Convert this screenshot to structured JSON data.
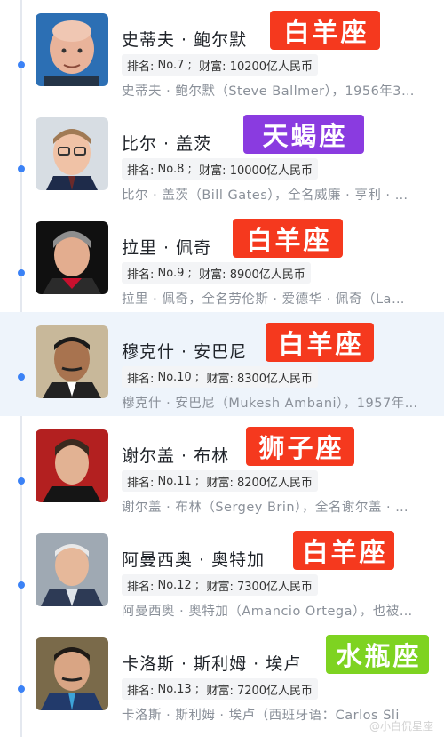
{
  "items": [
    {
      "name": "史蒂夫 · 鲍尔默",
      "zodiac": "白羊座",
      "zodiac_color": "#f5391e",
      "rank_label": "排名:",
      "rank": "No.7 ;",
      "wealth_label": "财富:",
      "wealth": "10200亿人民币",
      "desc": "史蒂夫 · 鲍尔默（Steve Ballmer），1956年3…",
      "photo": "steve-ballmer-photo"
    },
    {
      "name": "比尔 · 盖茨",
      "zodiac": "天蝎座",
      "zodiac_color": "#8a3be0",
      "rank_label": "排名:",
      "rank": "No.8 ;",
      "wealth_label": "财富:",
      "wealth": "10000亿人民币",
      "desc": "比尔 · 盖茨（Bill Gates），全名威廉 · 亨利 · …",
      "photo": "bill-gates-photo"
    },
    {
      "name": "拉里 · 佩奇",
      "zodiac": "白羊座",
      "zodiac_color": "#f5391e",
      "rank_label": "排名:",
      "rank": "No.9 ;",
      "wealth_label": "财富:",
      "wealth": "8900亿人民币",
      "desc": "拉里 · 佩奇，全名劳伦斯 · 爱德华 · 佩奇（La…",
      "photo": "larry-page-photo"
    },
    {
      "name": "穆克什 · 安巴尼",
      "zodiac": "白羊座",
      "zodiac_color": "#f5391e",
      "rank_label": "排名:",
      "rank": "No.10 ;",
      "wealth_label": "财富:",
      "wealth": "8300亿人民币",
      "desc": "穆克什 · 安巴尼（Mukesh Ambani），1957年…",
      "photo": "mukesh-ambani-photo"
    },
    {
      "name": "谢尔盖 · 布林",
      "zodiac": "狮子座",
      "zodiac_color": "#f5391e",
      "rank_label": "排名:",
      "rank": "No.11 ;",
      "wealth_label": "财富:",
      "wealth": "8200亿人民币",
      "desc": "谢尔盖 · 布林（Sergey Brin），全名谢尔盖 · …",
      "photo": "sergey-brin-photo"
    },
    {
      "name": "阿曼西奥 · 奥特加",
      "zodiac": "白羊座",
      "zodiac_color": "#f5391e",
      "rank_label": "排名:",
      "rank": "No.12 ;",
      "wealth_label": "财富:",
      "wealth": "7300亿人民币",
      "desc": "阿曼西奥 · 奥特加（Amancio Ortega），也被…",
      "photo": "amancio-ortega-photo"
    },
    {
      "name": "卡洛斯 · 斯利姆 · 埃卢",
      "zodiac": "水瓶座",
      "zodiac_color": "#7ed321",
      "rank_label": "排名:",
      "rank": "No.13 ;",
      "wealth_label": "财富:",
      "wealth": "7200亿人民币",
      "desc": "卡洛斯 · 斯利姆 · 埃卢（西班牙语：Carlos Sli",
      "photo": "carlos-slim-photo"
    }
  ],
  "watermark": "@小白侃星座"
}
